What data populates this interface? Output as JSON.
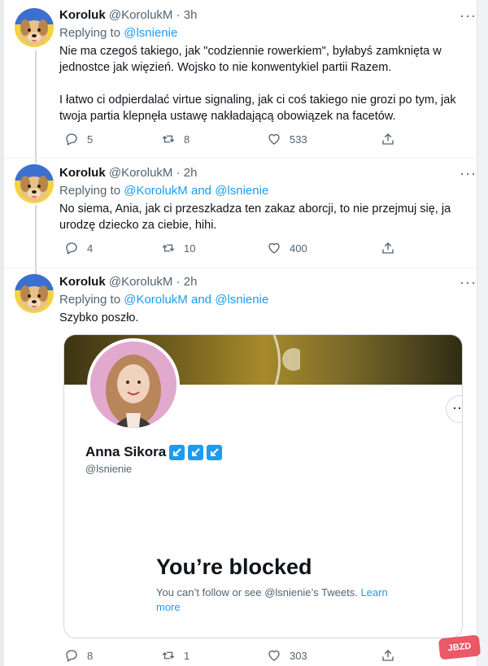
{
  "tweets": [
    {
      "name": "Koroluk",
      "handle": "@KorolukM",
      "dot": "·",
      "time": "3h",
      "replying_prefix": "Replying to",
      "mentions": [
        "@lsnienie"
      ],
      "text": [
        "Nie ma czegoś takiego, jak \"codziennie rowerkiem\", byłabyś zamknięta w jednostce jak więzień. Wojsko to nie konwentykiel partii Razem.",
        "I łatwo ci odpierdalać virtue signaling, jak ci coś takiego nie grozi po tym, jak twoja partia klepnęła ustawę nakładającą obowiązek na facetów."
      ],
      "replies": "5",
      "retweets": "8",
      "likes": "533"
    },
    {
      "name": "Koroluk",
      "handle": "@KorolukM",
      "dot": "·",
      "time": "2h",
      "replying_prefix": "Replying to",
      "mentions": [
        "@KorolukM",
        "@lsnienie"
      ],
      "and": "and",
      "text": [
        "No siema, Ania, jak ci przeszkadza ten zakaz aborcji, to nie przejmuj się, ja urodzę dziecko za ciebie, hihi."
      ],
      "replies": "4",
      "retweets": "10",
      "likes": "400"
    },
    {
      "name": "Koroluk",
      "handle": "@KorolukM",
      "dot": "·",
      "time": "2h",
      "replying_prefix": "Replying to",
      "mentions": [
        "@KorolukM",
        "@lsnienie"
      ],
      "and": "and",
      "text": [
        "Szybko poszło."
      ],
      "replies": "8",
      "retweets": "1",
      "likes": "303"
    }
  ],
  "embed": {
    "profile_name": "Anna Sikora",
    "profile_handle": "@lsnienie",
    "blocked_title": "You’re blocked",
    "blocked_text": "You can’t follow or see @lsnienie’s Tweets.",
    "learn_more": "Learn more"
  },
  "more_label": "···",
  "watermark": "JBZD",
  "colors": {
    "accent": "#1d9bf0",
    "text": "#0f1419",
    "muted": "#536471",
    "border": "#cfd9de"
  }
}
